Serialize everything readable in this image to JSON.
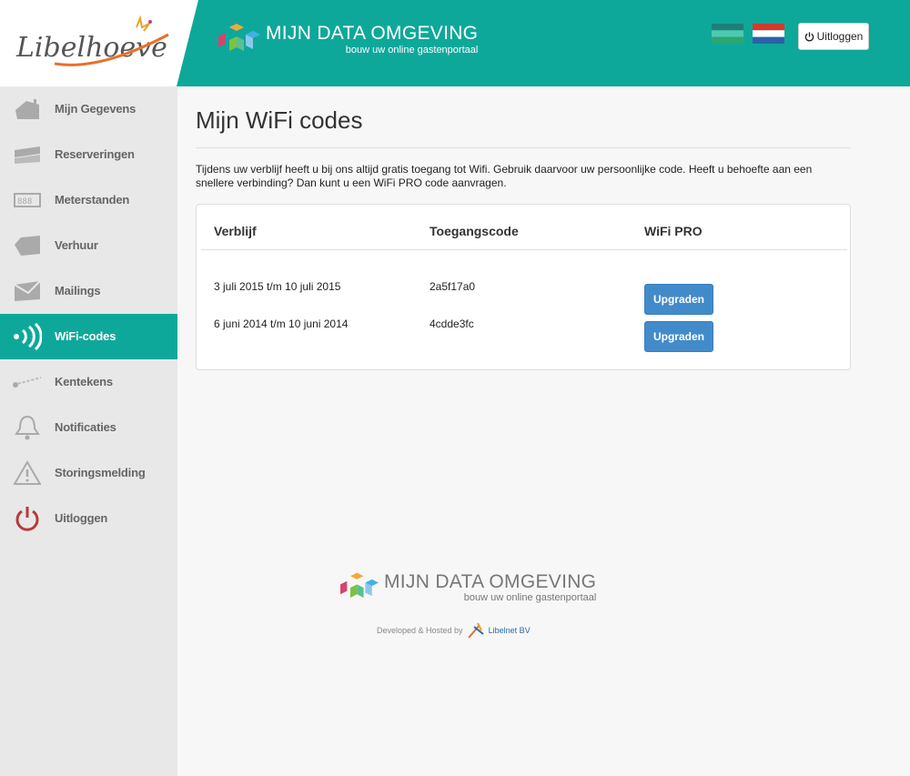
{
  "header": {
    "logo_text": "Libelhoeve",
    "brand_title": "MIJN DATA OMGEVING",
    "brand_subtitle": "bouw uw online gastenportaal",
    "logout_label": "Uitloggen"
  },
  "sidebar": {
    "items": [
      {
        "label": "Mijn Gegevens",
        "icon": "house-icon",
        "active": false
      },
      {
        "label": "Reserveringen",
        "icon": "ticket-icon",
        "active": false
      },
      {
        "label": "Meterstanden",
        "icon": "meter-icon",
        "active": false
      },
      {
        "label": "Verhuur",
        "icon": "tag-icon",
        "active": false
      },
      {
        "label": "Mailings",
        "icon": "envelope-icon",
        "active": false
      },
      {
        "label": "WiFi-codes",
        "icon": "wifi-icon",
        "active": true
      },
      {
        "label": "Kentekens",
        "icon": "key-icon",
        "active": false
      },
      {
        "label": "Notificaties",
        "icon": "bell-icon",
        "active": false
      },
      {
        "label": "Storingsmelding",
        "icon": "warning-icon",
        "active": false
      },
      {
        "label": "Uitloggen",
        "icon": "power-icon",
        "active": false
      }
    ]
  },
  "main": {
    "title": "Mijn WiFi codes",
    "intro": "Tijdens uw verblijf heeft u bij ons altijd gratis toegang tot Wifi. Gebruik daarvoor uw persoonlijke code. Heeft u behoefte aan een snellere verbinding? Dan kunt u een WiFi PRO code aanvragen.",
    "table": {
      "headers": [
        "Verblijf",
        "Toegangscode",
        "WiFi PRO"
      ],
      "rows": [
        {
          "stay": "3 juli 2015 t/m 10 juli 2015",
          "code": "2a5f17a0",
          "action": "Upgraden"
        },
        {
          "stay": "6 juni 2014 t/m 10 juni 2014",
          "code": "4cdde3fc",
          "action": "Upgraden"
        }
      ]
    }
  },
  "footer": {
    "brand_title": "MIJN DATA OMGEVING",
    "brand_subtitle": "bouw uw online gastenportaal",
    "developed_by": "Developed & Hosted by",
    "company": "Libelnet BV"
  },
  "colors": {
    "accent": "#0ea89a",
    "button": "#428bca",
    "sidebar_bg": "#e8e8e8",
    "icon_gray": "#aaaaaa",
    "logout_red": "#b83a3a"
  }
}
